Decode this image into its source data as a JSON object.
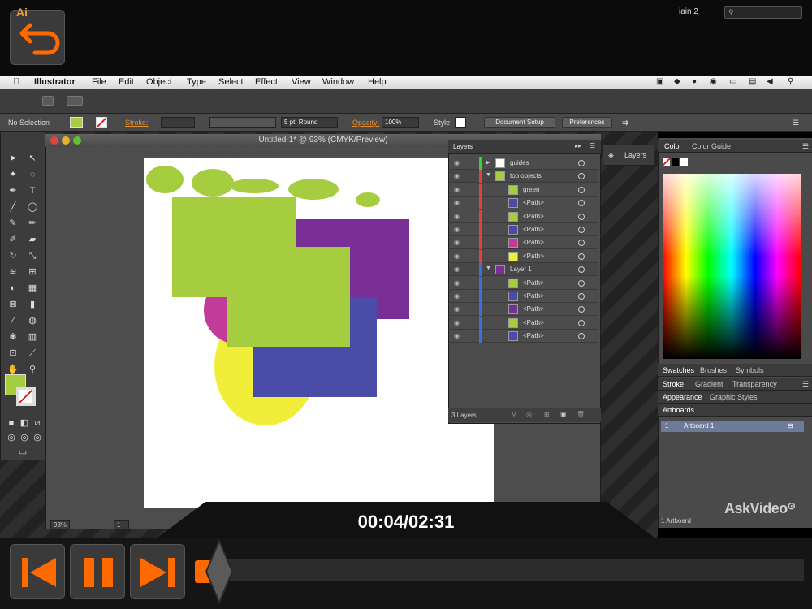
{
  "app": {
    "menubar": [
      "Illustrator",
      "File",
      "Edit",
      "Object",
      "Type",
      "Select",
      "Effect",
      "View",
      "Window",
      "Help"
    ],
    "user": "iain 2",
    "logo": "Ai"
  },
  "control_bar": {
    "selection": "No Selection",
    "stroke_label": "Stroke:",
    "brush": "5 pt. Round",
    "opacity_label": "Opacity:",
    "opacity_value": "100%",
    "style_label": "Style:",
    "document_setup": "Document Setup",
    "preferences": "Preferences"
  },
  "document": {
    "title": "Untitled-1* @ 93% (CMYK/Preview)",
    "zoom": "93%",
    "artboard_nav": "1"
  },
  "layers_panel": {
    "tab": "Layers",
    "rows": [
      {
        "name": "guides",
        "bar": "#3bd13b",
        "thumb": "#ffffff",
        "indent": 0,
        "arrow": "▶"
      },
      {
        "name": "top objects",
        "bar": "#e04040",
        "thumb": "#a6cd3f",
        "indent": 0,
        "arrow": "▼"
      },
      {
        "name": "green",
        "bar": "#e04040",
        "thumb": "#a6cd3f",
        "indent": 1,
        "arrow": ""
      },
      {
        "name": "<Path>",
        "bar": "#e04040",
        "thumb": "#4b4ba8",
        "indent": 1,
        "arrow": ""
      },
      {
        "name": "<Path>",
        "bar": "#e04040",
        "thumb": "#a6cd3f",
        "indent": 1,
        "arrow": ""
      },
      {
        "name": "<Path>",
        "bar": "#e04040",
        "thumb": "#4b4ba8",
        "indent": 1,
        "arrow": ""
      },
      {
        "name": "<Path>",
        "bar": "#e04040",
        "thumb": "#c23a9a",
        "indent": 1,
        "arrow": ""
      },
      {
        "name": "<Path>",
        "bar": "#e04040",
        "thumb": "#f1ee3a",
        "indent": 1,
        "arrow": ""
      },
      {
        "name": "Layer 1",
        "bar": "#3a6fe0",
        "thumb": "#7a2f96",
        "indent": 0,
        "arrow": "▼"
      },
      {
        "name": "<Path>",
        "bar": "#3a6fe0",
        "thumb": "#a6cd3f",
        "indent": 1,
        "arrow": ""
      },
      {
        "name": "<Path>",
        "bar": "#3a6fe0",
        "thumb": "#4b4ba8",
        "indent": 1,
        "arrow": ""
      },
      {
        "name": "<Path>",
        "bar": "#3a6fe0",
        "thumb": "#7a2f96",
        "indent": 1,
        "arrow": ""
      },
      {
        "name": "<Path>",
        "bar": "#3a6fe0",
        "thumb": "#a6cd3f",
        "indent": 1,
        "arrow": ""
      },
      {
        "name": "<Path>",
        "bar": "#3a6fe0",
        "thumb": "#4b4ba8",
        "indent": 1,
        "arrow": ""
      }
    ],
    "footer": "3 Layers"
  },
  "dock": {
    "layers_button": "Layers",
    "color_tab": "Color",
    "color_guide_tab": "Color Guide",
    "swatches_tab": "Swatches",
    "brushes_tab": "Brushes",
    "symbols_tab": "Symbols",
    "stroke_tab": "Stroke",
    "gradient_tab": "Gradient",
    "transparency_tab": "Transparency",
    "appearance_tab": "Appearance",
    "graphic_styles_tab": "Graphic Styles",
    "artboards_tab": "Artboards",
    "artboard_index": "1",
    "artboard_name": "Artboard 1",
    "artboard_count": "1 Artboard"
  },
  "video": {
    "time": "00:04/02:31",
    "brand": "AskVideo",
    "accent": "#ff6a00"
  },
  "colors": {
    "green": "#a6cd3f",
    "purple": "#7a2f96",
    "blue": "#4b4ba8",
    "magenta": "#c23a9a",
    "yellow": "#f1ee3a"
  }
}
